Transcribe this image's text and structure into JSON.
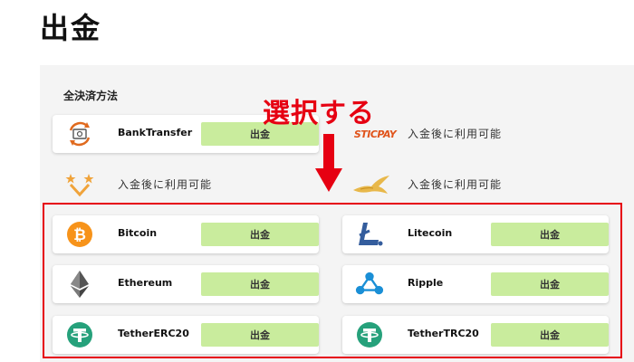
{
  "page": {
    "title": "出金"
  },
  "section": {
    "label": "全決済方法"
  },
  "callout": {
    "text": "選択する"
  },
  "methods": [
    {
      "name": "BankTransfer",
      "button": "出金",
      "icon": "bank-transfer-icon"
    },
    {
      "name": "",
      "logo_text": "STICPAY",
      "note": "入金後に利用可能",
      "icon": "sticpay-logo"
    },
    {
      "name": "",
      "note": "入金後に利用可能",
      "icon": "stars-chevron-logo"
    },
    {
      "name": "",
      "note": "入金後に利用可能",
      "icon": "bird-logo"
    },
    {
      "name": "Bitcoin",
      "button": "出金",
      "icon": "bitcoin-icon"
    },
    {
      "name": "Litecoin",
      "button": "出金",
      "icon": "litecoin-icon"
    },
    {
      "name": "Ethereum",
      "button": "出金",
      "icon": "ethereum-icon"
    },
    {
      "name": "Ripple",
      "button": "出金",
      "icon": "ripple-icon"
    },
    {
      "name": "TetherERC20",
      "button": "出金",
      "icon": "tether-icon"
    },
    {
      "name": "TetherTRC20",
      "button": "出金",
      "icon": "tether-icon"
    }
  ],
  "colors": {
    "button_bg": "#c9ec9d",
    "highlight": "#e60012",
    "bitcoin": "#f7931a",
    "litecoin": "#345d9d",
    "ripple": "#1a8fd6",
    "tether": "#26a17b"
  }
}
